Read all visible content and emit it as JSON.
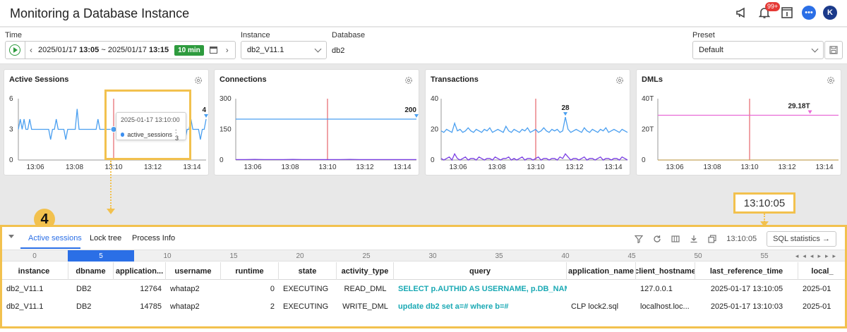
{
  "header": {
    "title": "Monitoring a Database Instance",
    "notification_count": "99+",
    "avatar_initial": "K"
  },
  "filters": {
    "time_label": "Time",
    "start_date": "2025/01/17",
    "start_time": "13:05",
    "range_sep": "~",
    "end_date": "2025/01/17",
    "end_time": "13:15",
    "duration": "10 min",
    "instance_label": "Instance",
    "instance_value": "db2_V11.1",
    "database_label": "Database",
    "database_value": "db2",
    "preset_label": "Preset",
    "preset_value": "Default"
  },
  "colors": {
    "accent": "#2b6fe6",
    "highlight": "#f2c14e",
    "series_blue": "#4a9ff0",
    "series_purple": "#7b3fe4",
    "series_pink": "#e86ad6",
    "marker_red": "#e0454c",
    "query_teal": "#1aa9b4",
    "duration_green": "#2e9b3e"
  },
  "tooltip": {
    "time": "2025-01-17 13:10:00",
    "series": "active_sessions",
    "value": ": 3"
  },
  "callout": {
    "number": "4",
    "time": "13:10:05"
  },
  "chart_data": [
    {
      "type": "line",
      "title": "Active Sessions",
      "x_ticks": [
        "13:06",
        "13:08",
        "13:10",
        "13:12",
        "13:14"
      ],
      "y_ticks": [
        "6",
        "3",
        "0"
      ],
      "ylim": [
        0,
        6
      ],
      "latest_label": "4",
      "marker_time": "13:10",
      "series": [
        {
          "values": [
            3,
            4,
            3,
            4,
            3,
            3,
            4,
            3,
            3,
            3,
            3,
            3,
            3,
            3,
            3,
            3,
            3,
            2,
            3,
            3,
            4,
            3,
            3,
            3,
            3,
            2,
            3,
            3,
            3,
            3,
            3,
            5,
            3,
            3,
            3,
            3,
            3,
            3,
            3,
            3,
            3,
            3,
            4,
            3,
            3,
            3,
            3,
            3,
            3,
            3,
            3,
            3,
            3,
            2,
            3,
            3,
            3,
            3,
            3,
            3,
            3,
            3,
            3,
            3,
            3,
            3,
            3,
            3,
            3,
            3,
            3,
            3,
            3,
            3,
            3,
            3,
            3,
            2,
            3,
            3,
            3,
            3,
            3,
            3,
            3,
            3,
            3,
            3,
            2,
            3,
            3,
            4,
            3,
            3,
            3,
            3,
            2,
            3,
            3,
            4
          ]
        }
      ]
    },
    {
      "type": "line",
      "title": "Connections",
      "x_ticks": [
        "13:06",
        "13:08",
        "13:10",
        "13:12",
        "13:14"
      ],
      "y_ticks": [
        "300",
        "150",
        "0"
      ],
      "ylim": [
        0,
        300
      ],
      "latest_label": "200",
      "marker_time": "13:10",
      "series": [
        {
          "values": [
            200,
            200,
            200,
            200,
            200,
            200,
            200,
            200,
            200,
            200,
            200,
            200,
            200,
            200,
            200,
            200,
            200,
            200,
            200,
            200
          ]
        },
        {
          "values": [
            2,
            2,
            3,
            2,
            2,
            2,
            3,
            2,
            2,
            2,
            2,
            2,
            3,
            2,
            2,
            2,
            2,
            2,
            2,
            2
          ]
        }
      ]
    },
    {
      "type": "line",
      "title": "Transactions",
      "x_ticks": [
        "13:06",
        "13:08",
        "13:10",
        "13:12",
        "13:14"
      ],
      "y_ticks": [
        "40",
        "20",
        "0"
      ],
      "ylim": [
        0,
        40
      ],
      "latest_label": "28",
      "marker_time": "13:10",
      "series": [
        {
          "values": [
            19,
            18,
            20,
            19,
            18,
            24,
            19,
            20,
            18,
            19,
            21,
            19,
            18,
            20,
            19,
            18,
            20,
            19,
            21,
            18,
            19,
            20,
            19,
            18,
            22,
            19,
            18,
            20,
            19,
            18,
            20,
            19,
            21,
            18,
            19,
            20,
            18,
            19,
            21,
            19,
            18,
            20,
            19,
            20,
            18,
            19,
            28,
            20,
            18,
            19,
            20,
            19,
            18,
            21,
            19,
            18,
            20,
            19,
            18,
            20,
            19,
            21,
            18,
            19,
            20,
            19,
            18,
            20,
            19,
            18
          ]
        },
        {
          "values": [
            1,
            0,
            1,
            2,
            0,
            4,
            1,
            0,
            1,
            2,
            0,
            1,
            1,
            0,
            2,
            1,
            0,
            1,
            1,
            0,
            2,
            1,
            0,
            1,
            1,
            2,
            0,
            1,
            0,
            1,
            2,
            0,
            1,
            1,
            0,
            1,
            2,
            0,
            1,
            1,
            0,
            1,
            1,
            0,
            2,
            1,
            4,
            2,
            0,
            1,
            1,
            0,
            1,
            2,
            0,
            1,
            1,
            0,
            1,
            2,
            0,
            1,
            1,
            0,
            1,
            1,
            0,
            2,
            1,
            0
          ]
        }
      ]
    },
    {
      "type": "line",
      "title": "DMLs",
      "x_ticks": [
        "13:06",
        "13:08",
        "13:10",
        "13:12",
        "13:14"
      ],
      "y_ticks": [
        "40T",
        "20T",
        "0"
      ],
      "ylim": [
        0,
        40
      ],
      "latest_label": "29.18T",
      "marker_time": "13:10",
      "series": [
        {
          "values": [
            29.18,
            29.18,
            29.18,
            29.18,
            29.18,
            29.18,
            29.18,
            29.18,
            29.18,
            29.18,
            29.18,
            29.18,
            29.18,
            29.18,
            29.18,
            29.18,
            29.18,
            29.18,
            29.18,
            29.18
          ]
        },
        {
          "values": [
            0,
            0,
            0,
            0,
            0,
            0,
            0,
            0,
            0,
            0,
            0,
            0,
            0,
            0,
            0,
            0,
            0,
            0,
            0,
            0
          ]
        }
      ]
    }
  ],
  "bottom": {
    "tabs": [
      "Active sessions",
      "Lock tree",
      "Process Info"
    ],
    "time": "13:10:05",
    "sql_stats_label": "SQL statistics",
    "timeline": [
      "0",
      "5",
      "10",
      "15",
      "20",
      "25",
      "30",
      "35",
      "40",
      "45",
      "50",
      "55"
    ],
    "timeline_active": 1,
    "columns": [
      "instance",
      "dbname",
      "application...",
      "username",
      "runtime",
      "state",
      "activity_type",
      "query",
      "application_name",
      "client_hostname",
      "last_reference_time",
      "local_"
    ],
    "rows": [
      [
        "db2_V11.1",
        "DB2",
        "12764",
        "whatap2",
        "0",
        "EXECUTING",
        "READ_DML",
        "SELECT p.AUTHID AS USERNAME, p.DB_NAM...",
        "",
        "127.0.0.1",
        "2025-01-17 13:10:05",
        "2025-01"
      ],
      [
        "db2_V11.1",
        "DB2",
        "14785",
        "whatap2",
        "2",
        "EXECUTING",
        "WRITE_DML",
        "update db2 set a=# where b=#",
        "CLP lock2.sql",
        "localhost.loc...",
        "2025-01-17 13:10:03",
        "2025-01"
      ]
    ]
  }
}
